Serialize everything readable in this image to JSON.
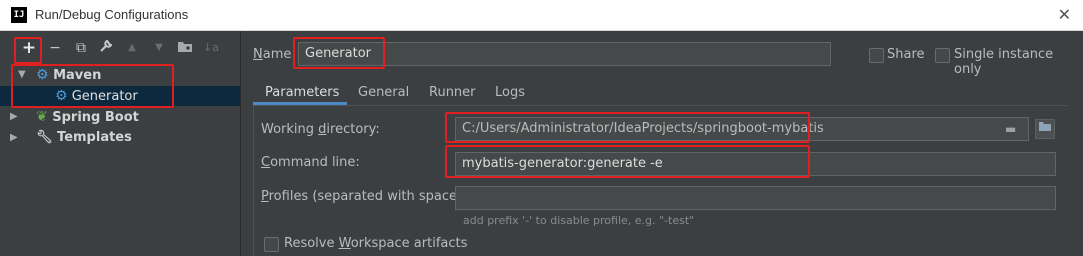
{
  "window": {
    "title": "Run/Debug Configurations",
    "app_icon_text": "IJ"
  },
  "toolbar": {
    "add": "+",
    "remove": "−",
    "copy": "⧉",
    "edit": "🔧",
    "move_up": "▲",
    "move_down": "▼",
    "folder": "📁",
    "sort": "↓a"
  },
  "tree": {
    "maven": "Maven",
    "generator": "Generator",
    "spring_boot": "Spring Boot",
    "templates": "Templates"
  },
  "form": {
    "name_label": "Name:",
    "name_value": "Generator",
    "share_label": "Share",
    "single_instance_label": "Single instance only"
  },
  "tabs": [
    "Parameters",
    "General",
    "Runner",
    "Logs"
  ],
  "params": {
    "working_dir_label": "Working directory:",
    "working_dir_value": "C:/Users/Administrator/IdeaProjects/springboot-mybatis",
    "command_line_label": "Command line:",
    "command_line_value": "mybatis-generator:generate -e",
    "profiles_label": "Profiles (separated with space):",
    "profiles_value": "",
    "profiles_hint": "add prefix '-' to disable profile, e.g. \"-test\"",
    "resolve_workspace_label": "Resolve Workspace artifacts"
  },
  "colors": {
    "highlight": "#e02020",
    "selection": "#0d293e",
    "accent": "#4a88c7"
  }
}
